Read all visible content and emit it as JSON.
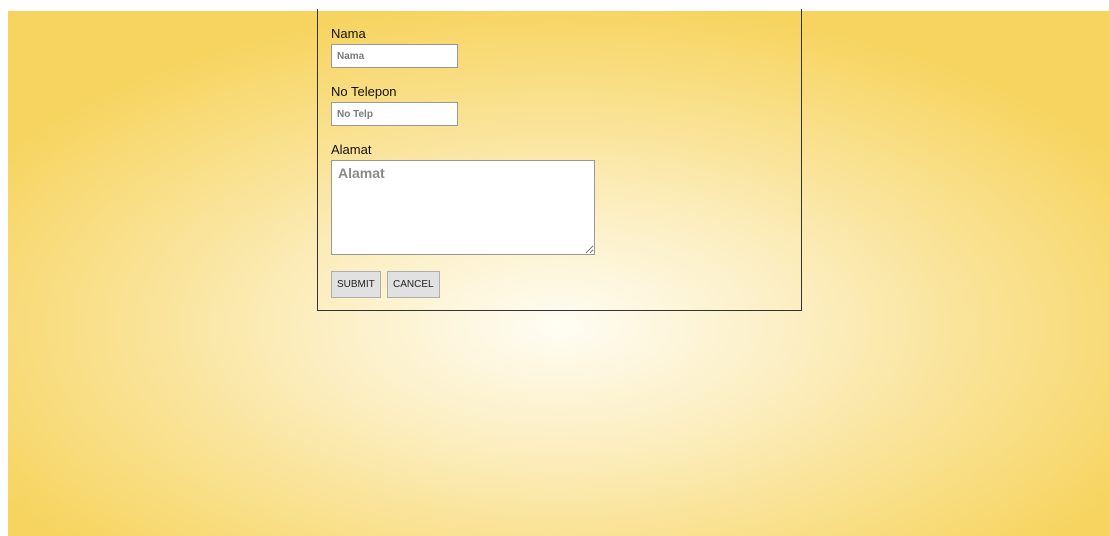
{
  "form": {
    "nama": {
      "label": "Nama",
      "placeholder": "Nama",
      "value": ""
    },
    "telepon": {
      "label": "No Telepon",
      "placeholder": "No Telp",
      "value": ""
    },
    "alamat": {
      "label": "Alamat",
      "placeholder": "Alamat",
      "value": ""
    },
    "buttons": {
      "submit": "SUBMIT",
      "cancel": "CANCEL"
    }
  },
  "colors": {
    "background_center": "#fffdf4",
    "background_edge": "#f7d45f",
    "border": "#333333",
    "button_bg": "#e1e1e1"
  }
}
